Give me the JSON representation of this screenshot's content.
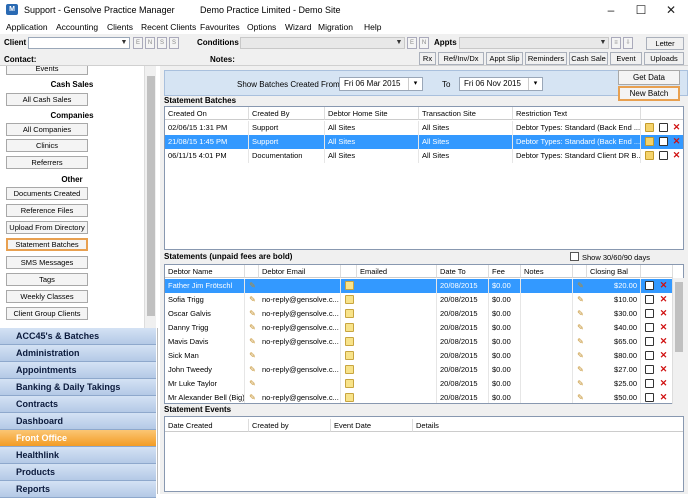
{
  "window": {
    "title": "Support - Gensolve Practice Manager",
    "subtitle": "Demo Practice Limited - Demo Site",
    "minimize": "–",
    "maximize": "☐",
    "close": "✕"
  },
  "menu": [
    "Application",
    "Accounting",
    "Clients",
    "Recent Clients",
    "Favourites",
    "Options",
    "Wizard",
    "Migration",
    "Help"
  ],
  "toolbar": {
    "client_label": "Client",
    "conditions_label": "Conditions",
    "appts_label": "Appts",
    "letter_btn": "Letter",
    "contact_label": "Contact:",
    "notes_label": "Notes:",
    "small_btn_e": "E",
    "small_btn_n": "N",
    "small_btn_s": "S",
    "buttons": [
      "Rx",
      "Ref/Inv/Dx",
      "Appt Slip",
      "Reminders",
      "Cash Sale",
      "Event",
      "Uploads"
    ]
  },
  "sidebar": {
    "items_top": [
      {
        "type": "btn",
        "label": "Events"
      },
      {
        "type": "head",
        "label": "Cash Sales"
      },
      {
        "type": "btn",
        "label": "All Cash Sales"
      },
      {
        "type": "head",
        "label": "Companies"
      },
      {
        "type": "btn",
        "label": "All Companies"
      },
      {
        "type": "btn",
        "label": "Clinics"
      },
      {
        "type": "btn",
        "label": "Referrers"
      },
      {
        "type": "head",
        "label": "Other"
      },
      {
        "type": "btn",
        "label": "Documents Created"
      },
      {
        "type": "btn",
        "label": "Reference Files"
      },
      {
        "type": "btn",
        "label": "Upload From Directory"
      },
      {
        "type": "btn",
        "label": "Statement Batches",
        "active": true
      },
      {
        "type": "btn",
        "label": "SMS Messages"
      },
      {
        "type": "btn",
        "label": "Tags"
      },
      {
        "type": "btn",
        "label": "Weekly Classes"
      },
      {
        "type": "btn",
        "label": "Client Group Clients"
      }
    ],
    "nav": [
      {
        "label": "ACC45's & Batches"
      },
      {
        "label": "Administration"
      },
      {
        "label": "Appointments"
      },
      {
        "label": "Banking & Daily Takings"
      },
      {
        "label": "Contracts"
      },
      {
        "label": "Dashboard"
      },
      {
        "label": "Front Office",
        "active": true
      },
      {
        "label": "Healthlink"
      },
      {
        "label": "Products"
      },
      {
        "label": "Reports"
      }
    ]
  },
  "filter": {
    "label": "Show Batches Created From",
    "from_date": "Fri  06 Mar 2015",
    "to_label": "To",
    "to_date": "Fri  06 Nov 2015",
    "get_data": "Get Data",
    "new_batch": "New Batch"
  },
  "statement_batches": {
    "title": "Statement Batches",
    "columns": [
      "Created On",
      "Created By",
      "Debtor Home Site",
      "Transaction Site",
      "Restriction Text"
    ],
    "rows": [
      {
        "created_on": "02/06/15 1:31 PM",
        "created_by": "Support",
        "home_site": "All Sites",
        "trans_site": "All Sites",
        "restriction": "Debtor Types: Standard (Back End ...",
        "selected": false
      },
      {
        "created_on": "21/08/15 1:45 PM",
        "created_by": "Support",
        "home_site": "All Sites",
        "trans_site": "All Sites",
        "restriction": "Debtor Types: Standard (Back End ...",
        "selected": true
      },
      {
        "created_on": "06/11/15 4:01 PM",
        "created_by": "Documentation",
        "home_site": "All Sites",
        "trans_site": "All Sites",
        "restriction": "Debtor Types: Standard Client DR B...",
        "selected": false
      }
    ]
  },
  "statements": {
    "title": "Statements (unpaid fees are bold)",
    "show_label": "Show 30/60/90 days",
    "columns": [
      "Debtor Name",
      "Debtor Email",
      "Emailed",
      "Date To",
      "Fee",
      "Notes",
      "Closing Bal"
    ],
    "rows": [
      {
        "name": "Father Jim Frötschl",
        "email": "",
        "emailed": "",
        "date_to": "20/08/2015",
        "fee": "$0.00",
        "notes": "",
        "closing": "$20.00",
        "selected": true
      },
      {
        "name": "Sofia Trigg",
        "email": "no-reply@gensolve.c...",
        "emailed": "",
        "date_to": "20/08/2015",
        "fee": "$0.00",
        "notes": "",
        "closing": "$10.00",
        "selected": false
      },
      {
        "name": "Oscar Galvis",
        "email": "no-reply@gensolve.c...",
        "emailed": "",
        "date_to": "20/08/2015",
        "fee": "$0.00",
        "notes": "",
        "closing": "$30.00",
        "selected": false
      },
      {
        "name": "Danny Trigg",
        "email": "no-reply@gensolve.c...",
        "emailed": "",
        "date_to": "20/08/2015",
        "fee": "$0.00",
        "notes": "",
        "closing": "$40.00",
        "selected": false
      },
      {
        "name": "Mavis Davis",
        "email": "no-reply@gensolve.c...",
        "emailed": "",
        "date_to": "20/08/2015",
        "fee": "$0.00",
        "notes": "",
        "closing": "$65.00",
        "selected": false
      },
      {
        "name": "Sick Man",
        "email": "",
        "emailed": "",
        "date_to": "20/08/2015",
        "fee": "$0.00",
        "notes": "",
        "closing": "$80.00",
        "selected": false
      },
      {
        "name": "John Tweedy",
        "email": "no-reply@gensolve.c...",
        "emailed": "",
        "date_to": "20/08/2015",
        "fee": "$0.00",
        "notes": "",
        "closing": "$27.00",
        "selected": false
      },
      {
        "name": "Mr Luke Taylor",
        "email": "",
        "emailed": "",
        "date_to": "20/08/2015",
        "fee": "$0.00",
        "notes": "",
        "closing": "$25.00",
        "selected": false
      },
      {
        "name": "Mr Alexander Bell (Big)",
        "email": "no-reply@gensolve.c...",
        "emailed": "",
        "date_to": "20/08/2015",
        "fee": "$0.00",
        "notes": "",
        "closing": "$50.00",
        "selected": false
      }
    ]
  },
  "statement_events": {
    "title": "Statement Events",
    "columns": [
      "Date Created",
      "Created by",
      "Event Date",
      "Details"
    ]
  },
  "colors": {
    "selection": "#3399ff",
    "nav_active": "#f39c25",
    "active_border": "#e8a050",
    "section_bg": "#d6e4f3"
  }
}
